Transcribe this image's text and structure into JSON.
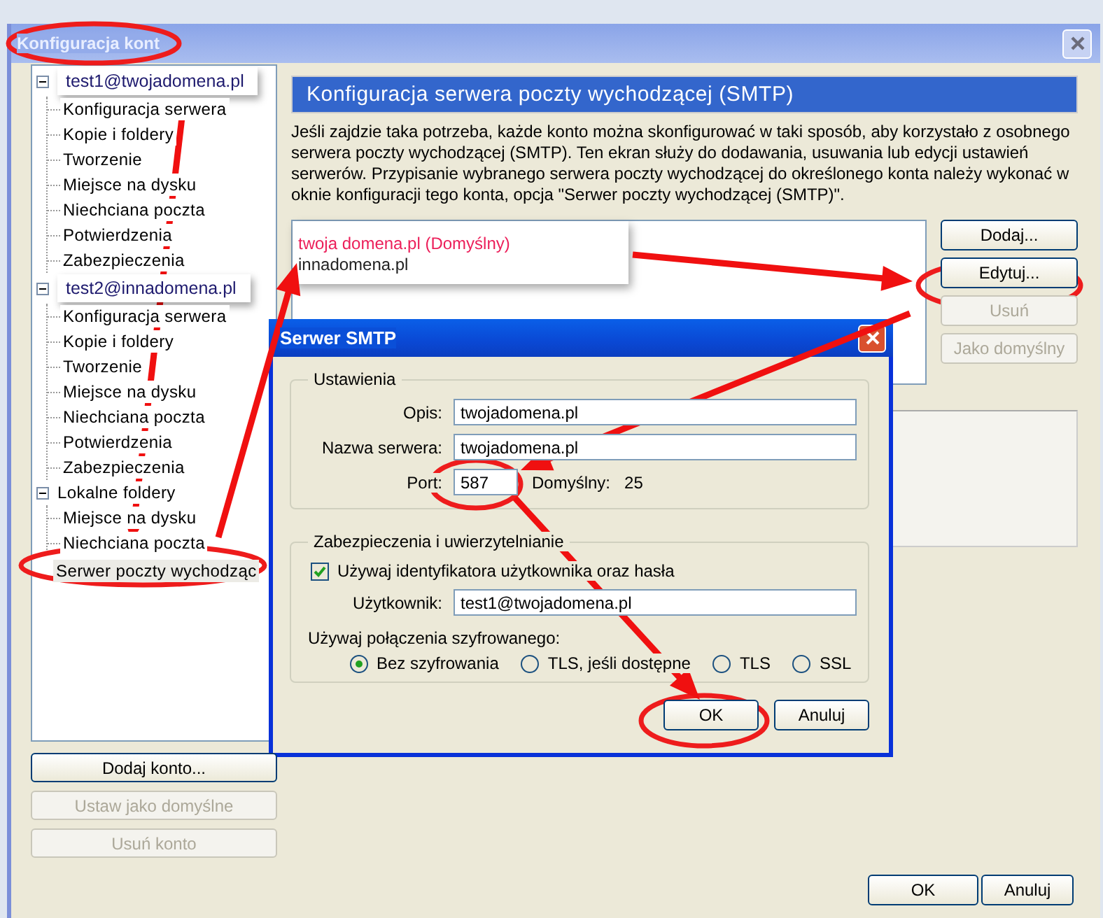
{
  "window": {
    "title": "Konfiguracja kont"
  },
  "tree": [
    {
      "label": "test1@twojadomena.pl",
      "kind": "callout",
      "expanded": true,
      "children": [
        {
          "label": "Konfiguracja serwera",
          "selected": false
        },
        {
          "label": "Kopie i foldery",
          "selected": false
        },
        {
          "label": "Tworzenie",
          "selected": false
        },
        {
          "label": "Miejsce na dysku",
          "selected": false
        },
        {
          "label": "Niechciana poczta",
          "selected": false
        },
        {
          "label": "Potwierdzenia",
          "selected": false
        },
        {
          "label": "Zabezpieczenia",
          "selected": false
        }
      ]
    },
    {
      "label": "test2@innadomena.pl",
      "kind": "callout",
      "expanded": true,
      "children": [
        {
          "label": "Konfiguracja serwera",
          "selected": false
        },
        {
          "label": "Kopie i foldery",
          "selected": false
        },
        {
          "label": "Tworzenie",
          "selected": false
        },
        {
          "label": "Miejsce na dysku",
          "selected": false
        },
        {
          "label": "Niechciana poczta",
          "selected": false
        },
        {
          "label": "Potwierdzenia",
          "selected": false
        },
        {
          "label": "Zabezpieczenia",
          "selected": false
        }
      ]
    },
    {
      "label": "Lokalne foldery",
      "kind": "folder",
      "expanded": true,
      "selected": false,
      "children": [
        {
          "label": "Miejsce na dysku",
          "selected": false
        },
        {
          "label": "Niechciana poczta",
          "selected": false
        }
      ]
    },
    {
      "label": "Serwer poczty wychodząc",
      "kind": "leaf",
      "selected": true
    }
  ],
  "account_buttons": [
    {
      "label": "Dodaj konto...",
      "disabled": false
    },
    {
      "label": "Ustaw jako domyślne",
      "disabled": true
    },
    {
      "label": "Usuń konto",
      "disabled": true
    }
  ],
  "panel": {
    "heading": "Konfiguracja serwera poczty wychodzącej (SMTP)",
    "description": "Jeśli zajdzie taka potrzeba, każde konto można skonfigurować w taki sposób, aby korzystało z osobnego serwera poczty wychodzącej (SMTP). Ten ekran służy do dodawania, usuwania lub edycji ustawień serwerów. Przypisanie wybranego serwera poczty wychodzącej do określonego konta należy wykonać w oknie konfiguracji tego konta, opcja \"Serwer poczty wychodzącej (SMTP)\".",
    "servers": [
      {
        "label": "twoja domena.pl (Domyślny)",
        "default": true
      },
      {
        "label": "innadomena.pl",
        "default": false
      }
    ],
    "buttons": [
      {
        "label": "Dodaj...",
        "disabled": false
      },
      {
        "label": "Edytuj...",
        "disabled": false
      },
      {
        "label": "Usuń",
        "disabled": true
      },
      {
        "label": "Jako domyślny",
        "disabled": true
      }
    ]
  },
  "footer_buttons": [
    {
      "label": "OK"
    },
    {
      "label": "Anuluj"
    }
  ],
  "dialog": {
    "title": "Serwer SMTP",
    "settings": {
      "legend": "Ustawienia",
      "fields": [
        {
          "label": "Opis:",
          "value": "twojadomena.pl"
        },
        {
          "label": "Nazwa serwera:",
          "value": "twojadomena.pl"
        }
      ],
      "port": {
        "label": "Port:",
        "value": "587",
        "default_label": "Domyślny:",
        "default_value": "25"
      }
    },
    "security": {
      "legend": "Zabezpieczenia i uwierzytelnianie",
      "auth": {
        "label": "Używaj identyfikatora użytkownika oraz hasła",
        "checked": true
      },
      "user": {
        "label": "Użytkownik:",
        "value": "test1@twojadomena.pl"
      },
      "encryption_label": "Używaj połączenia szyfrowanego:",
      "options": [
        {
          "label": "Bez szyfrowania",
          "selected": true
        },
        {
          "label": "TLS, jeśli dostępne",
          "selected": false
        },
        {
          "label": "TLS",
          "selected": false
        },
        {
          "label": "SSL",
          "selected": false
        }
      ]
    },
    "buttons": [
      {
        "label": "OK"
      },
      {
        "label": "Anuluj"
      }
    ]
  }
}
